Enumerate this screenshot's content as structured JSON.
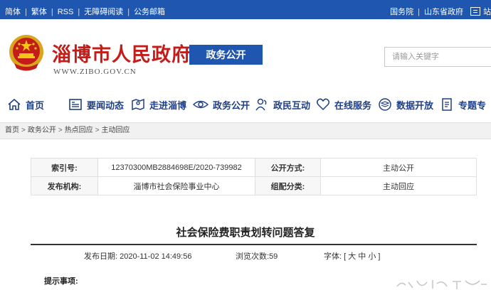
{
  "topbar": {
    "left_links": [
      "简体",
      "繁体",
      "RSS",
      "无障碍阅读",
      "公务邮箱"
    ],
    "right_links": [
      "国务院",
      "山东省政府"
    ],
    "right_cut": "站"
  },
  "header": {
    "title": "淄博市人民政府",
    "url": "WWW.ZIBO.GOV.CN",
    "section_button": "政务公开",
    "search_placeholder": "请输入关键字"
  },
  "nav": {
    "items": [
      {
        "label": "首页",
        "icon": "home-icon"
      },
      {
        "label": "要闻动态",
        "icon": "news-icon"
      },
      {
        "label": "走进淄博",
        "icon": "map-icon"
      },
      {
        "label": "政务公开",
        "icon": "eye-icon"
      },
      {
        "label": "政民互动",
        "icon": "people-icon"
      },
      {
        "label": "在线服务",
        "icon": "heart-icon"
      },
      {
        "label": "数据开放",
        "icon": "data-layers-icon"
      },
      {
        "label": "专题专",
        "icon": "document-icon"
      }
    ]
  },
  "breadcrumb": [
    "首页",
    "政务公开",
    "热点回应",
    "主动回应"
  ],
  "meta": {
    "index_label": "索引号:",
    "index_value": "12370300MB2884698E/2020-739982",
    "open_mode_label": "公开方式:",
    "open_mode_value": "主动公开",
    "publisher_label": "发布机构:",
    "publisher_value": "淄博市社会保险事业中心",
    "category_label": "组配分类:",
    "category_value": "主动回应"
  },
  "article": {
    "title": "社会保险费职责划转问题答复",
    "date_label": "发布日期:",
    "date_value": "2020-11-02 14:49:56",
    "views_label": "浏览次数:",
    "views_value": "59",
    "font_label": "字体:",
    "font_options": "[ 大 中 小 ]",
    "notice_label": "提示事项:"
  },
  "colors": {
    "brand_blue": "#1e56b0",
    "title_red": "#c41c18",
    "nav_text": "#1f3f86"
  }
}
